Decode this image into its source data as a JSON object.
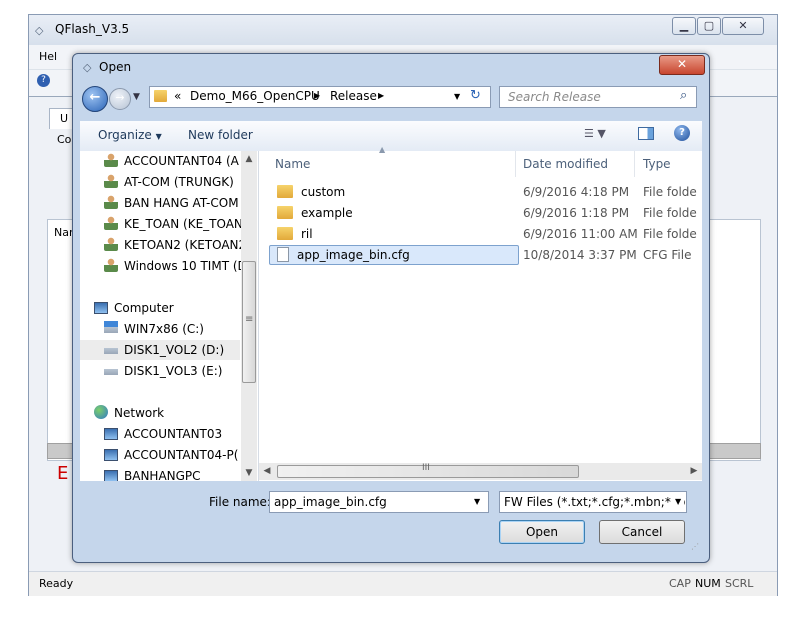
{
  "app": {
    "title": "QFlash_V3.5",
    "menu_help": "Hel",
    "tab_fragment": "U",
    "group_fragment": "Co",
    "name_fragment": "Nar",
    "error_fragment": "E",
    "status_text": "Ready",
    "indicators": [
      "CAP",
      "NUM",
      "SCRL"
    ]
  },
  "dialog": {
    "title": "Open",
    "path": [
      "«",
      "Demo_M66_OpenCPU",
      "Release"
    ],
    "search_placeholder": "Search Release",
    "toolbar": {
      "organize": "Organize",
      "new_folder": "New folder"
    },
    "nav": {
      "users": [
        "ACCOUNTANT04 (A",
        "AT-COM (TRUNGK)",
        "BAN HANG AT-COM",
        "KE_TOAN (KE_TOAN",
        "KETOAN2 (KETOAN2",
        "Windows 10 TIMT (D"
      ],
      "computer_label": "Computer",
      "drives": [
        "WIN7x86 (C:)",
        "DISK1_VOL2 (D:)",
        "DISK1_VOL3 (E:)"
      ],
      "network_label": "Network",
      "network_items": [
        "ACCOUNTANT03",
        "ACCOUNTANT04-P(",
        "BANHANGPC"
      ]
    },
    "columns": {
      "name": "Name",
      "date": "Date modified",
      "type": "Type"
    },
    "files": [
      {
        "name": "custom",
        "date": "6/9/2016 4:18 PM",
        "type": "File folde",
        "kind": "folder"
      },
      {
        "name": "example",
        "date": "6/9/2016 1:18 PM",
        "type": "File folde",
        "kind": "folder"
      },
      {
        "name": "ril",
        "date": "6/9/2016 11:00 AM",
        "type": "File folde",
        "kind": "folder"
      },
      {
        "name": "app_image_bin.cfg",
        "date": "10/8/2014 3:37 PM",
        "type": "CFG File",
        "kind": "file",
        "selected": true
      }
    ],
    "filename_label": "File name:",
    "filename_value": "app_image_bin.cfg",
    "filter_value": "FW Files (*.txt;*.cfg;*.mbn;*.lod,",
    "open_label": "Open",
    "cancel_label": "Cancel",
    "hscroll_grip": "III",
    "vscroll_grip": "≡"
  },
  "colors": {
    "selection": "#d9e8fb",
    "selection_border": "#7da2ce",
    "close_red": "#c8462f",
    "error_red": "#cc0000"
  }
}
